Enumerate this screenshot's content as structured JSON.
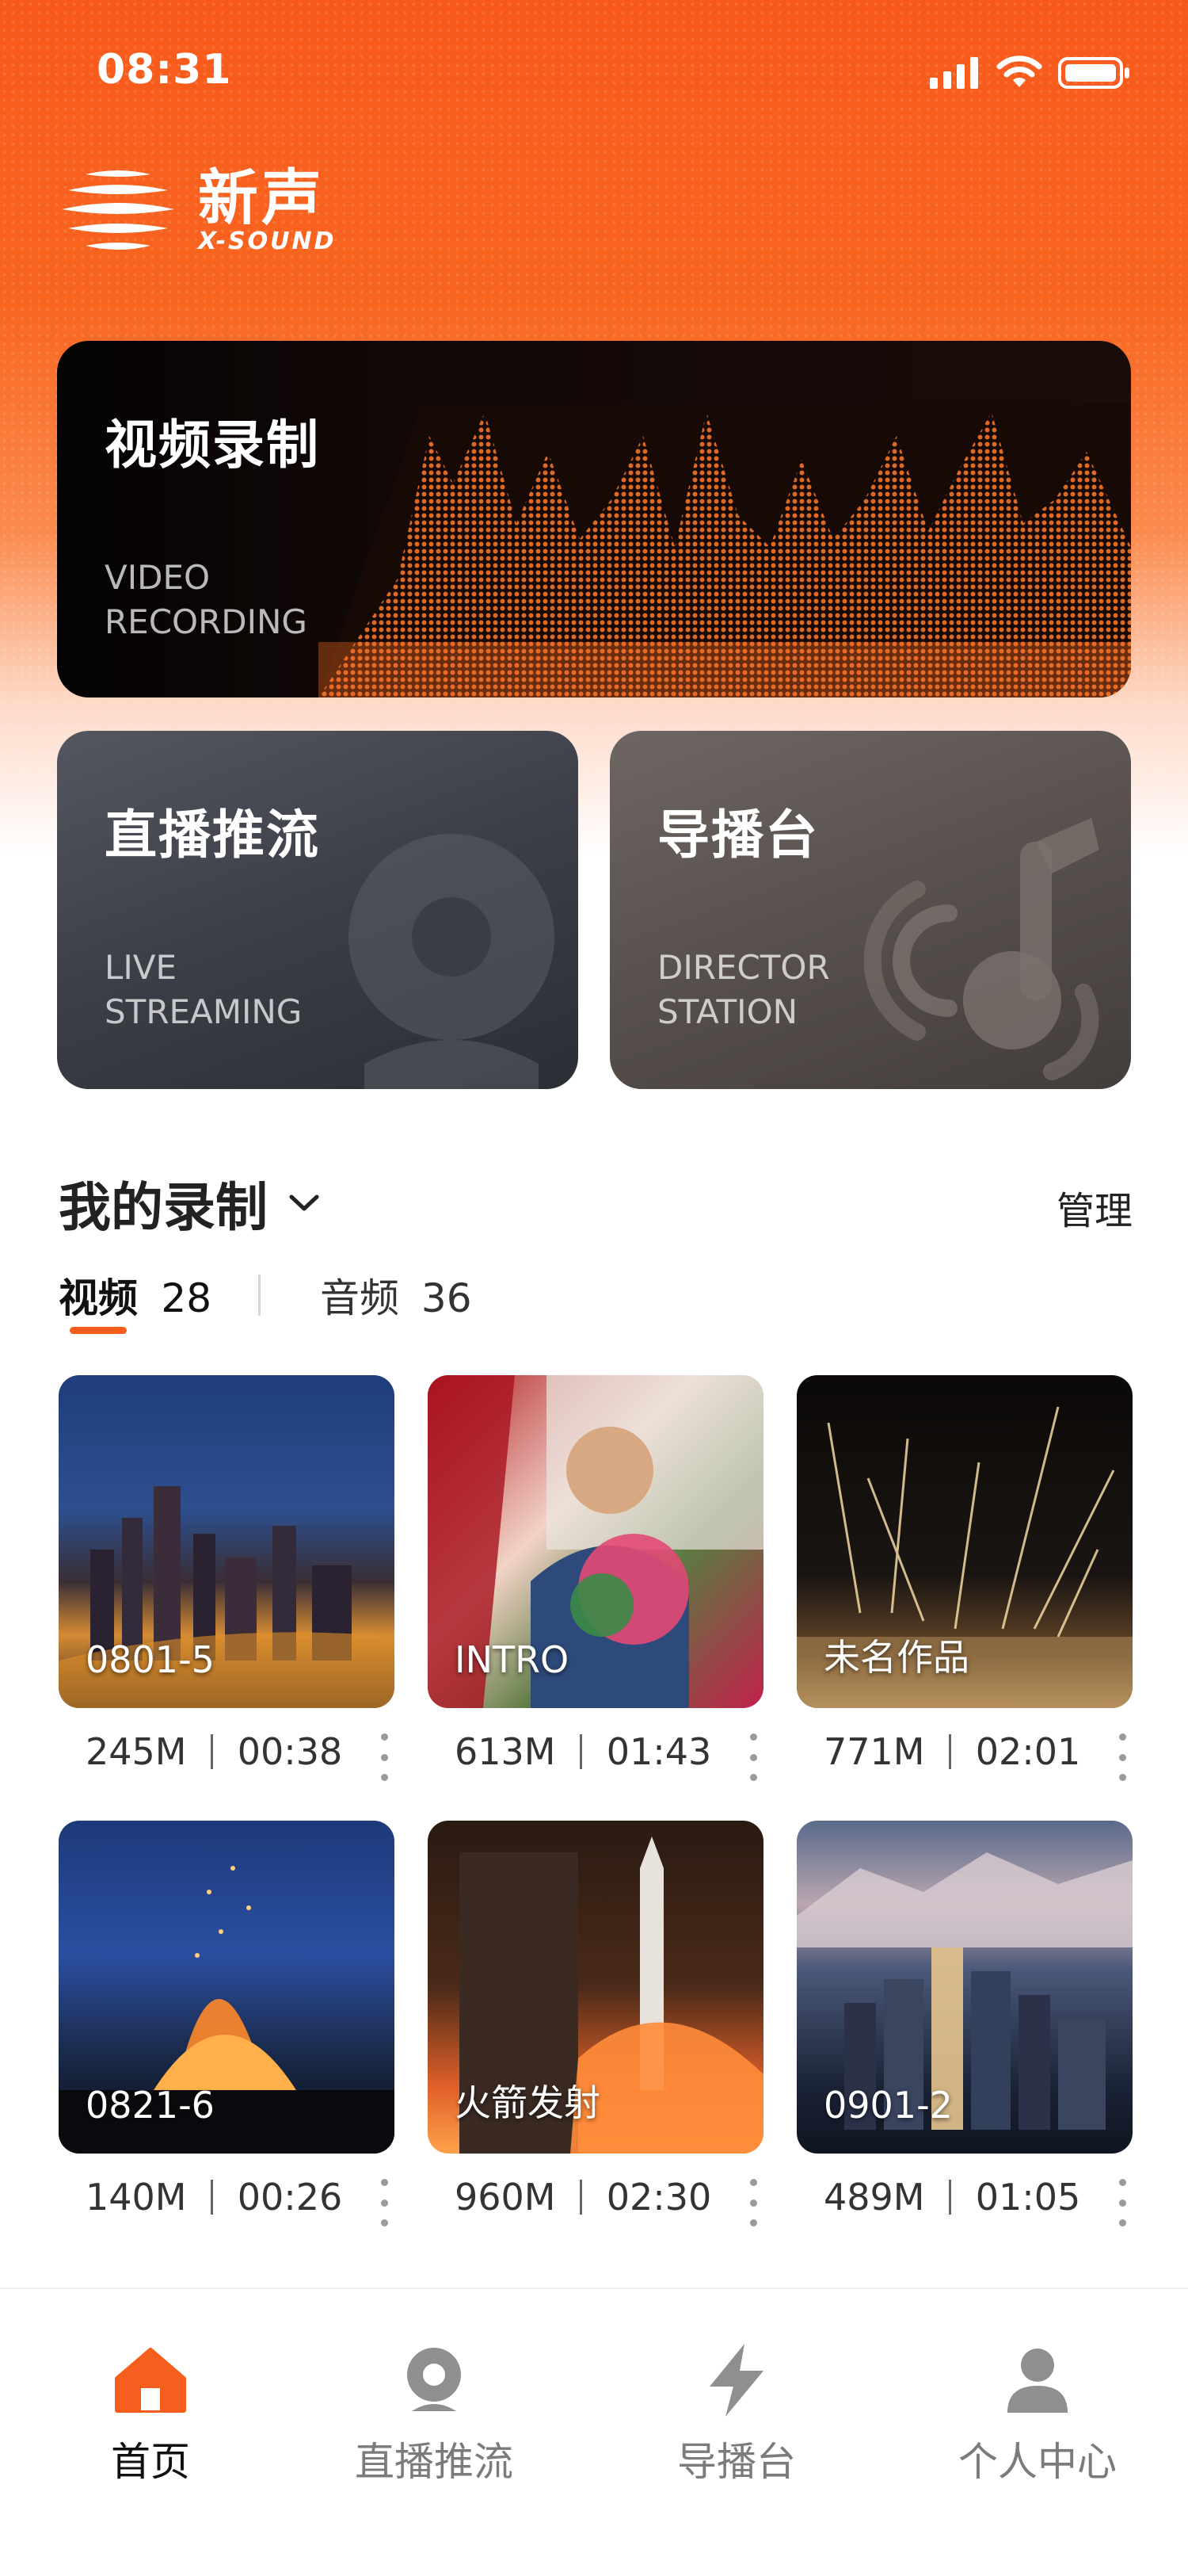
{
  "status_bar": {
    "time": "08:31"
  },
  "brand": {
    "name_cn": "新声",
    "name_en": "X-SOUND"
  },
  "cards": {
    "video": {
      "title": "视频录制",
      "subtitle_1": "VIDEO",
      "subtitle_2": "RECORDING"
    },
    "live": {
      "title": "直播推流",
      "subtitle_1": "LIVE",
      "subtitle_2": "STREAMING"
    },
    "director": {
      "title": "导播台",
      "subtitle_1": "DIRECTOR",
      "subtitle_2": "STATION"
    }
  },
  "section": {
    "title": "我的录制",
    "manage": "管理"
  },
  "tabs": {
    "video": {
      "label": "视频",
      "count": "28"
    },
    "audio": {
      "label": "音频",
      "count": "36"
    }
  },
  "recordings": [
    {
      "name": "0801-5",
      "size": "245M",
      "duration": "00:38"
    },
    {
      "name": "INTRO",
      "size": "613M",
      "duration": "01:43"
    },
    {
      "name": "未名作品",
      "size": "771M",
      "duration": "02:01"
    },
    {
      "name": "0821-6",
      "size": "140M",
      "duration": "00:26"
    },
    {
      "name": "火箭发射",
      "size": "960M",
      "duration": "02:30"
    },
    {
      "name": "0901-2",
      "size": "489M",
      "duration": "01:05"
    }
  ],
  "bottom_nav": [
    {
      "label": "首页",
      "icon": "home-icon"
    },
    {
      "label": "直播推流",
      "icon": "webcam-icon"
    },
    {
      "label": "导播台",
      "icon": "lightning-icon"
    },
    {
      "label": "个人中心",
      "icon": "user-icon"
    }
  ],
  "colors": {
    "accent": "#f65e1d",
    "hero": "#f8591b"
  }
}
